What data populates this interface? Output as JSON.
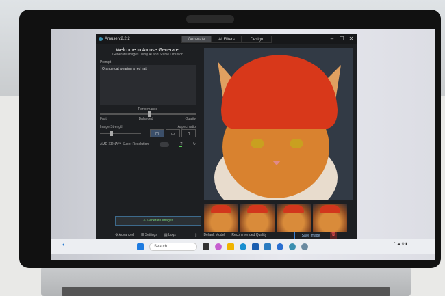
{
  "app": {
    "title": "Amuse v2.2.2",
    "tabs": [
      "Generate",
      "AI Filters",
      "Design"
    ],
    "active_tab": "Generate",
    "window_controls": {
      "minimize": "–",
      "maximize": "☐",
      "close": "✕"
    }
  },
  "left": {
    "welcome": "Welcome to Amuse Generate!",
    "subtitle": "Generate images using AI and Stable Diffusion",
    "prompt_label": "Prompt",
    "prompt_value": "Orange cat wearing a red hat",
    "performance_label": "Performance",
    "perf_min": "Fast",
    "perf_mid": "Balanced",
    "perf_max": "Quality",
    "performance_value": 0.5,
    "image_strength_label": "Image Strength",
    "image_strength_value": 0.25,
    "aspect_label": "Aspect ratio",
    "aspect_selected": "square",
    "super_res_label": "AMD XDNA™ Super Resolution",
    "generate_button": "Generate Images"
  },
  "bottom": {
    "advanced": "Advanced",
    "settings": "Settings",
    "logs": "Logs",
    "info1": "Default Model",
    "info2": "Recommended Quality",
    "save": "Save Image",
    "delete": "🗑"
  },
  "taskbar": {
    "search_placeholder": "Search"
  },
  "colors": {
    "accent": "#3b7fd0",
    "app_bg": "#1d1f22",
    "generate_text": "#7cd67c"
  }
}
